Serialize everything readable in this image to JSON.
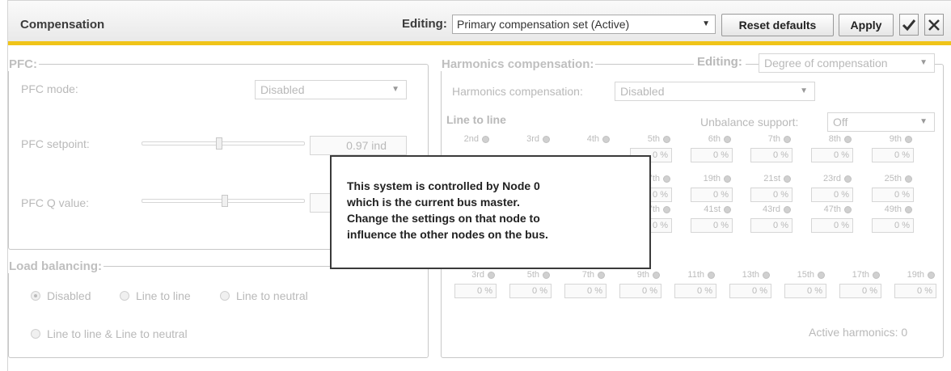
{
  "header": {
    "title": "Compensation",
    "editing_label": "Editing:",
    "editing_value": "Primary compensation set (Active)",
    "reset_label": "Reset defaults",
    "apply_label": "Apply",
    "arrow": "▼"
  },
  "pfc": {
    "legend": "PFC:",
    "mode_label": "PFC mode:",
    "mode_value": "Disabled",
    "setpoint_label": "PFC setpoint:",
    "setpoint_value": "0.97 ind",
    "q_label": "PFC Q value:"
  },
  "load": {
    "legend": "Load balancing:",
    "options": [
      "Disabled",
      "Line to line",
      "Line to neutral",
      "Line to line & Line to neutral"
    ],
    "selected": "Disabled"
  },
  "harm": {
    "legend": "Harmonics compensation:",
    "editing_label": "Editing:",
    "editing_value": "Degree of compensation",
    "hc_label": "Harmonics compensation:",
    "hc_value": "Disabled",
    "ltl_label": "Line to line",
    "unbalance_label": "Unbalance support:",
    "unbalance_value": "Off",
    "active_label": "Active harmonics: 0",
    "ltl_rows": [
      [
        {
          "h": "2nd",
          "v": ""
        },
        {
          "h": "3rd",
          "v": ""
        },
        {
          "h": "4th",
          "v": ""
        },
        {
          "h": "5th",
          "v": "0 %"
        },
        {
          "h": "6th",
          "v": "0 %"
        },
        {
          "h": "7th",
          "v": "0 %"
        },
        {
          "h": "8th",
          "v": "0 %"
        },
        {
          "h": "9th",
          "v": "0 %"
        }
      ],
      [
        {
          "h": "17th",
          "v": "0 %"
        },
        {
          "h": "19th",
          "v": "0 %"
        },
        {
          "h": "21st",
          "v": "0 %"
        },
        {
          "h": "23rd",
          "v": "0 %"
        },
        {
          "h": "25th",
          "v": "0 %"
        }
      ],
      [
        {
          "h": "37th",
          "v": "0 %"
        },
        {
          "h": "41st",
          "v": "0 %"
        },
        {
          "h": "43rd",
          "v": "0 %"
        },
        {
          "h": "47th",
          "v": "0 %"
        },
        {
          "h": "49th",
          "v": "0 %"
        }
      ]
    ],
    "ltn_row": [
      {
        "h": "3rd",
        "v": "0 %"
      },
      {
        "h": "5th",
        "v": "0 %"
      },
      {
        "h": "7th",
        "v": "0 %"
      },
      {
        "h": "9th",
        "v": "0 %"
      },
      {
        "h": "11th",
        "v": "0 %"
      },
      {
        "h": "13th",
        "v": "0 %"
      },
      {
        "h": "15th",
        "v": "0 %"
      },
      {
        "h": "17th",
        "v": "0 %"
      },
      {
        "h": "19th",
        "v": "0 %"
      }
    ]
  },
  "overlay": {
    "lines": [
      "This system is controlled by Node 0",
      "which is the current bus master.",
      "Change the settings on that node to",
      "influence the other nodes on the bus."
    ]
  },
  "icons": {
    "check": "check-icon",
    "close": "close-icon",
    "dot": "status-dot-icon"
  },
  "colors": {
    "accent": "#f0c419"
  }
}
